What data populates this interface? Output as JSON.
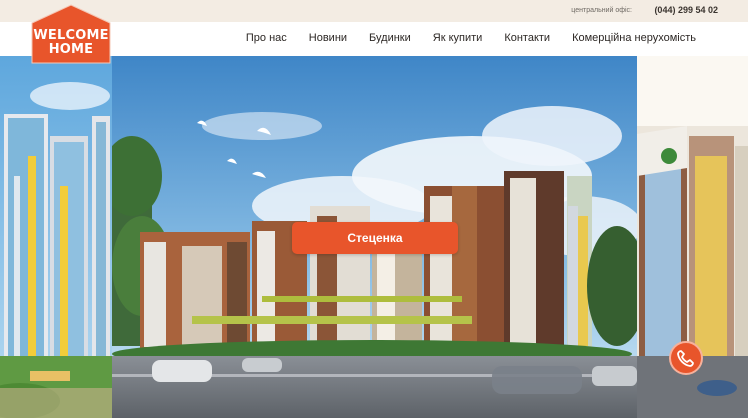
{
  "header": {
    "office_label": "центральний офіс:",
    "phone": "(044) 299 54 02",
    "logo": {
      "line1": "WELCOME",
      "line2": "HOME"
    }
  },
  "nav": {
    "items": [
      "Про нас",
      "Новини",
      "Будинки",
      "Як купити",
      "Контакти",
      "Комерційна нерухомість"
    ]
  },
  "hero": {
    "cta_label": "Стеценка"
  },
  "icons": {
    "call": "phone-icon",
    "logo": "house-logo-icon"
  },
  "colors": {
    "accent": "#e8552b",
    "topbar": "#f3ece3"
  }
}
